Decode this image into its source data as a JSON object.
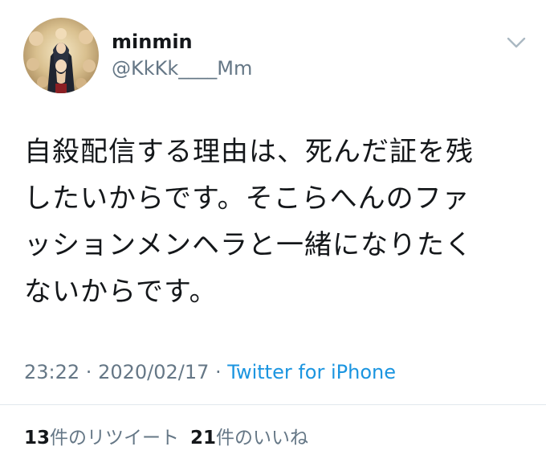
{
  "user": {
    "display_name": "minmin",
    "handle": "@KkKk____Mm",
    "avatar_icon": "madonna-painting-avatar"
  },
  "menu": {
    "icon": "chevron-down-icon"
  },
  "tweet": {
    "text": "自殺配信する理由は、死んだ証を残\nしたいからです。そこらへんのファ\nッションメンヘラと一緒になりたく\nないからです。"
  },
  "meta": {
    "time": "23:22",
    "separator": " · ",
    "date": "2020/02/17",
    "source": "Twitter for iPhone"
  },
  "stats": {
    "retweets_count": "13",
    "retweets_label": "件のリツイート",
    "likes_count": "21",
    "likes_label": "件のいいね"
  },
  "colors": {
    "text": "#14171a",
    "secondary": "#657786",
    "link": "#1b95e0",
    "divider": "#e1e8ed"
  }
}
